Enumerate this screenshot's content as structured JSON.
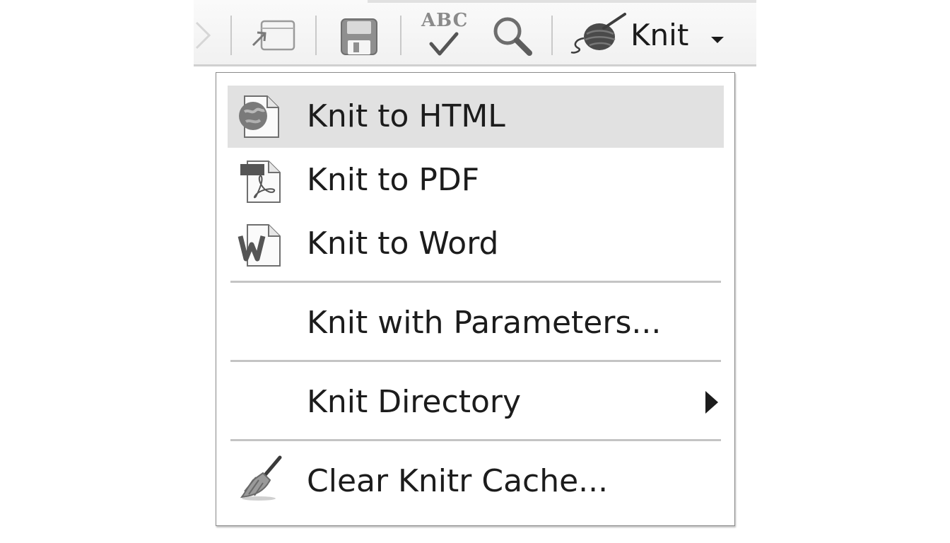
{
  "toolbar": {
    "knit_label": "Knit",
    "spell_check_text": "ABC",
    "buttons": [
      {
        "name": "forward-arrow",
        "icon": "chevron-right-icon"
      },
      {
        "name": "show-in-window",
        "icon": "popout-window-icon"
      },
      {
        "name": "save",
        "icon": "floppy-disk-icon"
      },
      {
        "name": "spell-check",
        "icon": "spellcheck-icon"
      },
      {
        "name": "find",
        "icon": "magnifier-icon"
      },
      {
        "name": "knit",
        "icon": "yarn-ball-icon"
      }
    ]
  },
  "menu": {
    "items": [
      {
        "label": "Knit to HTML",
        "icon": "html-globe-document-icon",
        "highlighted": true
      },
      {
        "label": "Knit to PDF",
        "icon": "pdf-document-icon"
      },
      {
        "label": "Knit to Word",
        "icon": "word-document-icon"
      },
      {
        "label": "Knit with Parameters..."
      },
      {
        "label": "Knit Directory",
        "has_submenu": true
      },
      {
        "label": "Clear Knitr Cache...",
        "icon": "broom-icon"
      }
    ]
  },
  "colors": {
    "highlight": "#e1e1e1",
    "text": "#1c1c1c",
    "separator": "#c4c4c4"
  }
}
